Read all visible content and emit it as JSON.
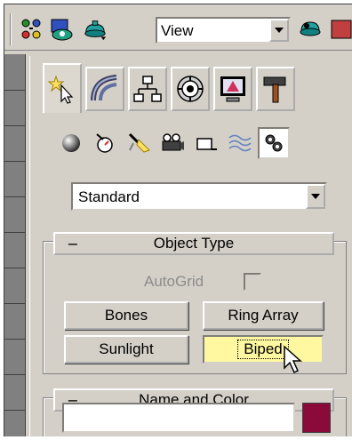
{
  "toolbar": {
    "view_dropdown": {
      "value": "View"
    }
  },
  "command_panel": {
    "tabs": [
      {
        "icon": "create-icon",
        "active": true
      },
      {
        "icon": "modify-icon",
        "active": false
      },
      {
        "icon": "hierarchy-icon",
        "active": false
      },
      {
        "icon": "motion-icon",
        "active": false
      },
      {
        "icon": "display-icon",
        "active": false
      },
      {
        "icon": "utilities-icon",
        "active": false
      }
    ],
    "subcategories": [
      {
        "icon": "geometry-sphere-icon"
      },
      {
        "icon": "shapes-icon"
      },
      {
        "icon": "lights-icon"
      },
      {
        "icon": "cameras-icon"
      },
      {
        "icon": "helpers-icon"
      },
      {
        "icon": "space-warps-icon"
      },
      {
        "icon": "systems-icon",
        "active": true
      }
    ],
    "category_dropdown": {
      "value": "Standard"
    },
    "object_type_rollout": {
      "collapse_symbol": "−",
      "title": "Object Type",
      "autogrid_label": "AutoGrid",
      "autogrid_checked": false,
      "buttons": [
        "Bones",
        "Ring Array",
        "Sunlight",
        "Biped"
      ],
      "pressed_button": "Biped"
    },
    "name_color_rollout": {
      "collapse_symbol": "−",
      "title": "Name and Color",
      "name_value": "",
      "swatch_color": "#8a0a3a"
    }
  }
}
